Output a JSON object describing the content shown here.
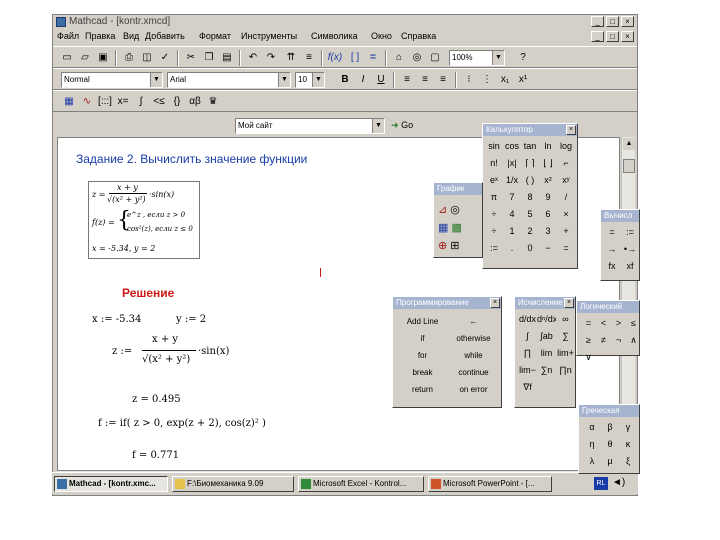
{
  "window": {
    "title": "Mathcad - [kontr.xmcd]",
    "controls": [
      "_",
      "□",
      "×"
    ],
    "doc_controls": [
      "_",
      "□",
      "×"
    ]
  },
  "menu": [
    "Файл",
    "Правка",
    "Вид",
    "Добавить",
    "Формат",
    "Инструменты",
    "Символика",
    "Окно",
    "Справка"
  ],
  "toolbar": {
    "buttons": [
      "new-icon",
      "open-icon",
      "save-icon",
      "print-icon",
      "preview-icon",
      "spell-icon",
      "cut-icon",
      "copy-icon",
      "paste-icon",
      "undo-icon",
      "redo-icon",
      "align-icon",
      "function-icon",
      "units-icon",
      "equals-icon",
      "resources-icon",
      "component-icon",
      "tree-icon",
      "help-icon"
    ],
    "zoom": "100%"
  },
  "format": {
    "style": "Normal",
    "font": "Arial",
    "size": "10",
    "bold": "B",
    "italic": "I",
    "underline": "U"
  },
  "math_toolbar": [
    "calculator-icon",
    "graph-icon",
    "matrix-icon",
    "evaluation-icon",
    "calculus-icon",
    "boolean-icon",
    "programming-icon",
    "greek-icon",
    "symbolic-icon"
  ],
  "resource": {
    "value": "Мой сайт",
    "go": "Go"
  },
  "document": {
    "heading": "Задание 2. Вычислить значение функции",
    "task_z_left": "z =",
    "task_z_numer": "x + y",
    "task_z_denom": "√(x² + y²)",
    "task_z_tail": "·sin(x)",
    "task_f_left": "f(z) =",
    "task_f_case1": "e^z ,   если z > 0",
    "task_f_case2": "cos²(z),  если z ≤ 0",
    "task_values": "x = -5.34,  y = 2",
    "solution": "Решение",
    "x_def": "x := -5.34",
    "y_def": "y := 2",
    "z_def_left": "z :=",
    "z_def_numer": "x + y",
    "z_def_denom": "√(x² + y²)",
    "z_def_tail": "·sin(x)",
    "z_result": "z = 0.495",
    "f_def": "f := if( z > 0, exp(z + 2), cos(z)² )",
    "f_result": "f = 0.771"
  },
  "taskbar": [
    {
      "label": "Mathcad - [kontr.xmc...",
      "active": true
    },
    {
      "label": "F:\\Биомеханика 9.09",
      "active": false
    },
    {
      "label": "Microsoft Excel - Kontrol...",
      "active": false
    },
    {
      "label": "Microsoft PowerPoint - [...",
      "active": false
    }
  ],
  "tray": "RL",
  "palettes": {
    "calculator": {
      "title": "Калькулятор",
      "keys": [
        "sin",
        "cos",
        "tan",
        "ln",
        "log",
        "n!",
        "|x|",
        "⌈ ⌉",
        "⌊ ⌋",
        "⌐",
        "eˣ",
        "1/x",
        "( )",
        "x²",
        "xʸ",
        "π",
        "7",
        "8",
        "9",
        "/",
        "÷",
        "4",
        "5",
        "6",
        "×",
        "÷",
        "1",
        "2",
        "3",
        "+",
        ":=",
        ".",
        "0",
        "−",
        "="
      ]
    },
    "graph": {
      "title": "График"
    },
    "evaluation": {
      "title": "Вычисл",
      "keys": [
        "=",
        ":=",
        "→",
        "•→",
        "fx",
        "xf"
      ]
    },
    "programming": {
      "title": "Программирование",
      "keys": [
        "Add Line",
        "←",
        "if",
        "otherwise",
        "for",
        "while",
        "break",
        "continue",
        "return",
        "on error"
      ]
    },
    "calculus": {
      "title": "Исчисление",
      "keys": [
        "d/dx",
        "dⁿ/dxⁿ",
        "∞",
        "∫",
        "∫ab",
        "∑",
        "∏",
        "lim",
        "lim+",
        "lim−",
        "∑n",
        "∏n",
        "∇f"
      ]
    },
    "boolean": {
      "title": "Логический",
      "keys": [
        "=",
        "<",
        ">",
        "≤",
        "≥",
        "≠",
        "¬",
        "∧",
        "∨"
      ]
    },
    "greek": {
      "title": "Греческая",
      "keys": [
        "α",
        "β",
        "γ",
        "η",
        "θ",
        "κ",
        "λ",
        "μ",
        "ξ"
      ]
    }
  }
}
